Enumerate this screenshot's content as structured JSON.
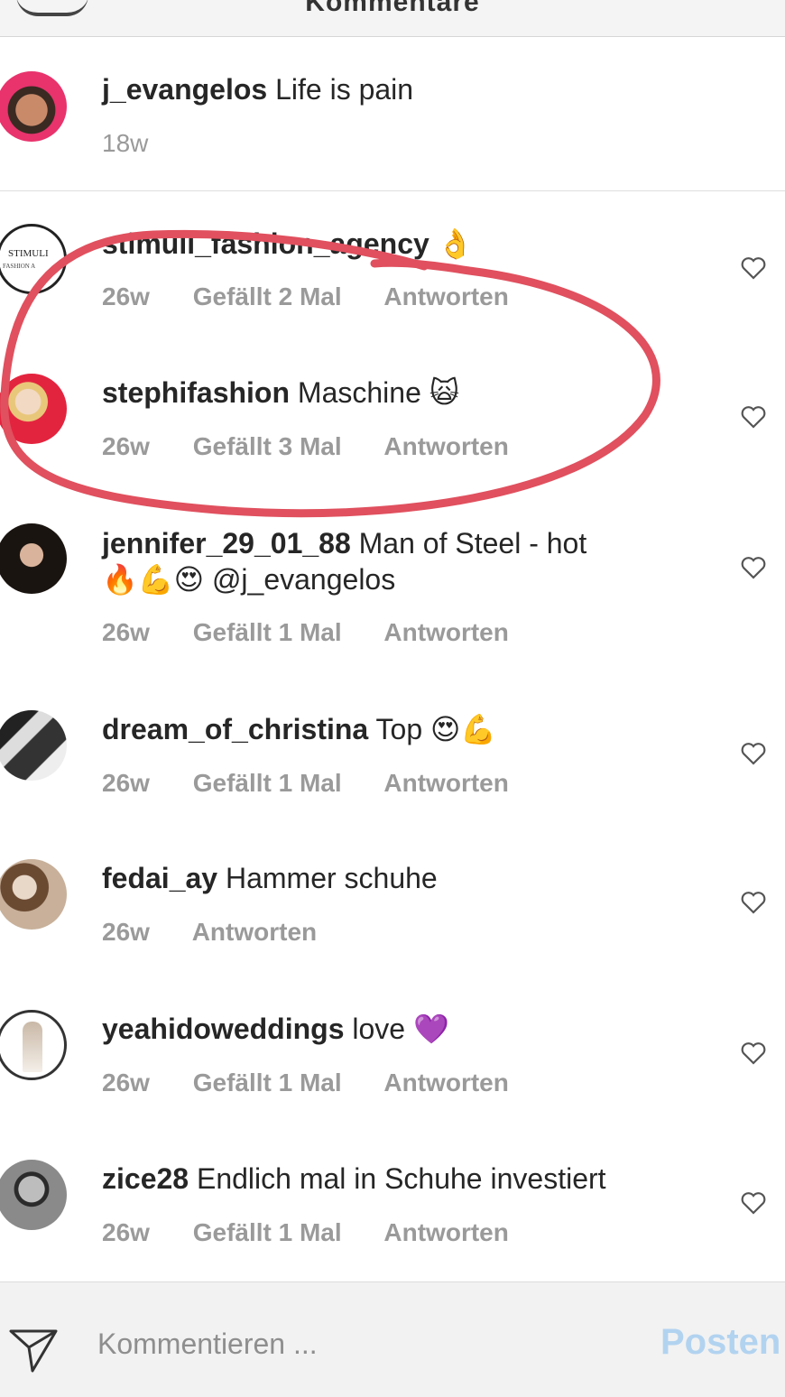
{
  "header": {
    "title": "Kommentare"
  },
  "caption": {
    "username": "j_evangelos",
    "text": "Life is pain",
    "time": "18w"
  },
  "comments": [
    {
      "username": "stimuli_fashion_agency",
      "text": "👌",
      "time": "26w",
      "likes": "Gefällt 2 Mal",
      "reply": "Antworten",
      "avatar_text": "STIMULI",
      "avatar_subtext": "FASHION A"
    },
    {
      "username": "stephifashion",
      "text": "Maschine 🙀",
      "time": "26w",
      "likes": "Gefällt 3 Mal",
      "reply": "Antworten"
    },
    {
      "username": "jennifer_29_01_88",
      "text": "Man of Steel - hot",
      "text2": "🔥💪😍 @j_evangelos",
      "time": "26w",
      "likes": "Gefällt 1 Mal",
      "reply": "Antworten"
    },
    {
      "username": "dream_of_christina",
      "text": "Top 😍💪",
      "time": "26w",
      "likes": "Gefällt 1 Mal",
      "reply": "Antworten"
    },
    {
      "username": "fedai_ay",
      "text": "Hammer schuhe",
      "time": "26w",
      "likes": "",
      "reply": "Antworten"
    },
    {
      "username": "yeahidoweddings",
      "text": "love 💜",
      "time": "26w",
      "likes": "Gefällt 1 Mal",
      "reply": "Antworten"
    },
    {
      "username": "zice28",
      "text": "Endlich mal in Schuhe investiert",
      "time": "26w",
      "likes": "Gefällt 1 Mal",
      "reply": "Antworten"
    }
  ],
  "footer": {
    "placeholder": "Kommentieren ...",
    "post_label": "Posten"
  },
  "colors": {
    "accent": "#b2d3f0",
    "meta": "#9a9a9a",
    "highlight": "#e0505e"
  },
  "icons": {
    "like": "heart-icon",
    "send": "paper-plane-icon"
  }
}
